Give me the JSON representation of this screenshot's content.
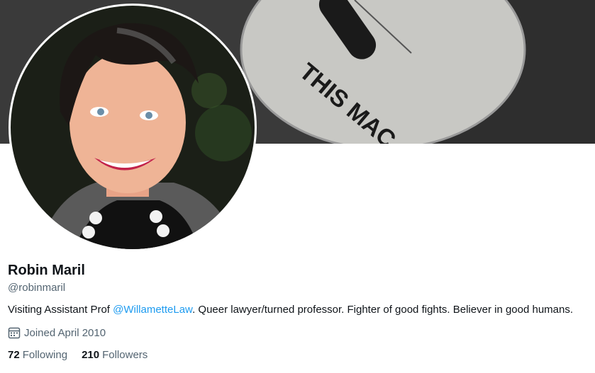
{
  "profile": {
    "name": "Robin Maril",
    "handle": "@robinmaril",
    "bio_prefix": "Visiting Assistant Prof ",
    "bio_mention": "@WillametteLaw",
    "bio_suffix": ". Queer lawyer/turned professor. Fighter of good fights. Believer in good humans.",
    "joined": "Joined April 2010",
    "joined_icon": "calendar-icon",
    "following_count": "72",
    "following_label": "Following",
    "followers_count": "210",
    "followers_label": "Followers"
  },
  "banner": {
    "guitar_text": "THIS MAC"
  },
  "colors": {
    "link": "#1d9bf0",
    "secondary_text": "#536471",
    "primary_text": "#0f1419"
  }
}
